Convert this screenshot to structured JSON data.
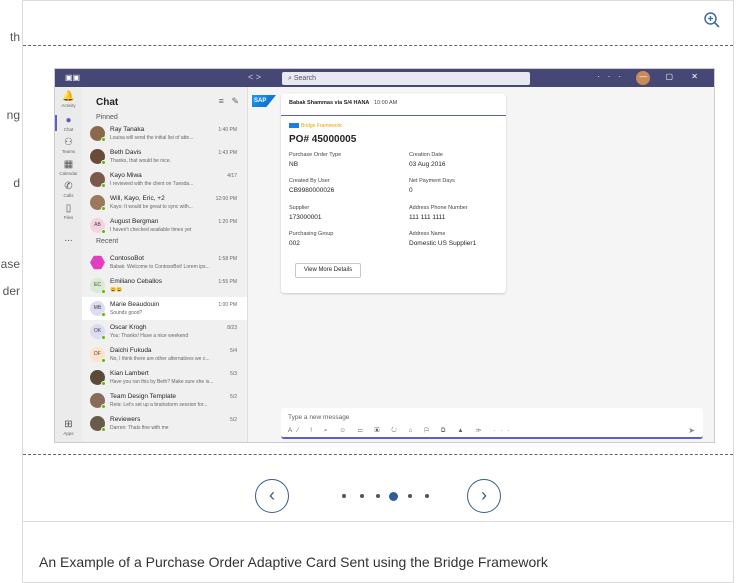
{
  "left_clip": [
    "th",
    "ng",
    "d",
    "ase",
    "der"
  ],
  "titlebar": {
    "search_placeholder": "Search",
    "nav": "< >"
  },
  "rail": [
    {
      "label": "Activity",
      "icon": "bell-icon"
    },
    {
      "label": "Chat",
      "icon": "chat-icon",
      "active": true
    },
    {
      "label": "Teams",
      "icon": "teams-icon"
    },
    {
      "label": "Calendar",
      "icon": "calendar-icon"
    },
    {
      "label": "Calls",
      "icon": "phone-icon"
    },
    {
      "label": "Files",
      "icon": "file-icon"
    },
    {
      "label": "...",
      "icon": "more-icon"
    },
    {
      "label": "Apps",
      "icon": "apps-icon"
    }
  ],
  "chat": {
    "title": "Chat",
    "pinned_label": "Pinned",
    "recent_label": "Recent",
    "items": [
      {
        "name": "Ray Tanaka",
        "time": "1:40 PM",
        "preview": "Louisa will send the initial list of atte...",
        "initials": "",
        "color": "#8a6a4a"
      },
      {
        "name": "Beth Davis",
        "time": "1:43 PM",
        "preview": "Thanks, that would be nice.",
        "initials": "",
        "color": "#6a4a3a"
      },
      {
        "name": "Kayo Miwa",
        "time": "4/17",
        "preview": "I reviewed with the client on Tuesda...",
        "initials": "",
        "color": "#7a5a4a"
      },
      {
        "name": "Will, Kayo, Eric, +2",
        "time": "12:00 PM",
        "preview": "Kayo: It would be great to sync with...",
        "initials": "",
        "color": "#9a7a5a"
      },
      {
        "name": "August Bergman",
        "time": "1:20 PM",
        "preview": "I haven't checked available times yet",
        "initials": "AB",
        "color": "#f7d3dd"
      },
      {
        "name": "ContosoBot",
        "time": "1:58 PM",
        "preview": "Babak: Welcome to ContosoBot! Lorem ips...",
        "initials": "",
        "color": "#e040c0"
      },
      {
        "name": "Emiliano Ceballos",
        "time": "1:55 PM",
        "preview": "😀😀",
        "initials": "EC",
        "color": "#d9ebd0"
      },
      {
        "name": "Marie Beaudouin",
        "time": "1:00 PM",
        "preview": "Sounds good?",
        "initials": "MB",
        "color": "#dcdcf2"
      },
      {
        "name": "Oscar Krogh",
        "time": "8/23",
        "preview": "You: Thanks! Have a nice weekend",
        "initials": "OK",
        "color": "#dcdcf2"
      },
      {
        "name": "Daichi Fukuda",
        "time": "5/4",
        "preview": "No, I think there are other alternatives we c...",
        "initials": "DF",
        "color": "#fbe4c8"
      },
      {
        "name": "Kian Lambert",
        "time": "5/3",
        "preview": "Have you ran this by Beth? Make sure she is...",
        "initials": "",
        "color": "#5a4a3a"
      },
      {
        "name": "Team Design Template",
        "time": "5/2",
        "preview": "Reta: Let's set up a brainstorm session for...",
        "initials": "",
        "color": "#8a6a5a"
      },
      {
        "name": "Reviewers",
        "time": "5/2",
        "preview": "Darren: Thats fine with me",
        "initials": "",
        "color": "#6a5a4a"
      }
    ]
  },
  "card": {
    "sender": "Babak Shammas via S/4 HANA",
    "sent_time": "10:00 AM",
    "bridge": "Bridge Framework",
    "po": "PO# 45000005",
    "fields": [
      {
        "label": "Purchase Order Type",
        "value": "NB"
      },
      {
        "label": "Creation Date",
        "value": "03 Aug 2016"
      },
      {
        "label": "Created By User",
        "value": "CB9980000026"
      },
      {
        "label": "Net Payment Days",
        "value": "0"
      },
      {
        "label": "Supplier",
        "value": "173000001"
      },
      {
        "label": "Address Phone Number",
        "value": "111 111 1111"
      },
      {
        "label": "Purchasing Group",
        "value": "002"
      },
      {
        "label": "Address Name",
        "value": "Domestic US Supplier1"
      }
    ],
    "button": "View More Details"
  },
  "composer": {
    "placeholder": "Type a new message"
  },
  "pagination": {
    "count": 6,
    "active_index": 3
  },
  "caption": "An Example of a Purchase Order Adaptive Card Sent using the Bridge Framework"
}
